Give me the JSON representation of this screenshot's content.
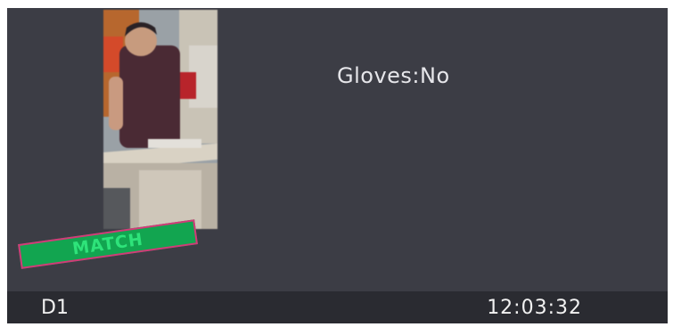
{
  "result": {
    "attribute_text": "Gloves:No",
    "match_label": "MATCH"
  },
  "footer": {
    "channel": "D1",
    "time": "12:03:32"
  },
  "colors": {
    "panel_bg": "#3c3d45",
    "footer_bg": "#2a2b31",
    "match_green": "#12a550",
    "match_border": "#d23a78"
  }
}
